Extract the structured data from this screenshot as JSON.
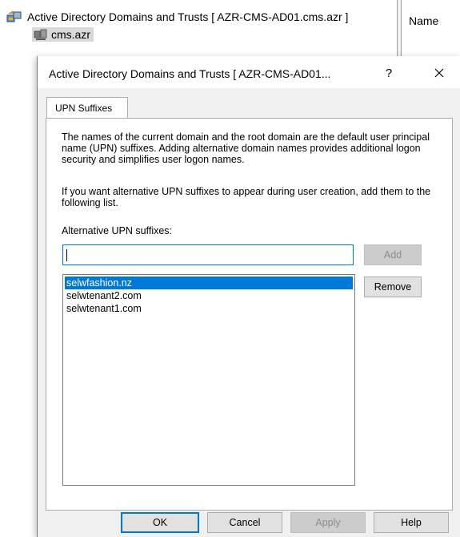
{
  "console": {
    "tree_root_label": "Active Directory Domains and Trusts [ AZR-CMS-AD01.cms.azr ]",
    "tree_child_label": "cms.azr",
    "column_header": "Name"
  },
  "dialog": {
    "title": "Active Directory Domains and Trusts [ AZR-CMS-AD01...",
    "help_label": "?",
    "close_label": "✕",
    "tab_label": "UPN Suffixes",
    "description_1": "The names of the current domain and the root domain are the default user principal name (UPN) suffixes. Adding alternative domain names provides additional logon security and simplifies user logon names.",
    "description_2": "If you want alternative UPN suffixes to appear during user creation, add them to the following list.",
    "field_label": "Alternative UPN suffixes:",
    "input_value": "",
    "add_label": "Add",
    "remove_label": "Remove",
    "suffixes": [
      "selwfashion.nz",
      "selwtenant2.com",
      "selwtenant1.com"
    ],
    "selected_index": 0,
    "ok_label": "OK",
    "cancel_label": "Cancel",
    "apply_label": "Apply",
    "help_button_label": "Help"
  },
  "colors": {
    "selection": "#0078d7",
    "dialog_face": "#f0f0f0",
    "button_face": "#e1e1e1"
  }
}
